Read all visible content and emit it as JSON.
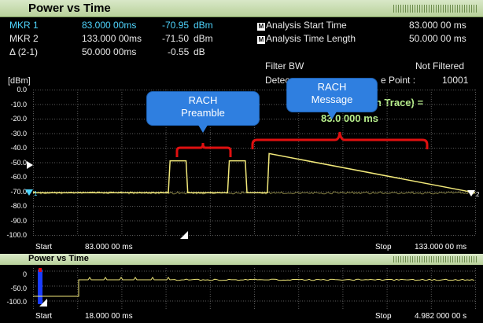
{
  "title": "Power vs Time",
  "markers": [
    {
      "name": "MKR 1",
      "time": "83.000 00ms",
      "value": "-70.95",
      "unit": "dBm"
    },
    {
      "name": "MKR 2",
      "time": "133.000 00ms",
      "value": "-71.50",
      "unit": "dBm"
    },
    {
      "name": "Δ (2-1)",
      "time": "50.000 00ms",
      "value": "-0.55",
      "unit": "dB"
    }
  ],
  "analysis": {
    "start_label": "Analysis Start Time",
    "start_value": "83.000 00 ms",
    "length_label": "Analysis Time Length",
    "length_value": "50.000 00 ms",
    "filter_label": "Filter BW",
    "filter_value": "Not Filtered",
    "detect_label": "Detec",
    "points_label": "e Point :",
    "points_value": "10001",
    "trace_fragment": "n Trace) =",
    "time_fragment": "83.0      000 ms"
  },
  "y_unit": "[dBm]",
  "y_ticks": [
    "0.0",
    "-10.0",
    "-20.0",
    "-30.0",
    "-40.0",
    "-50.0",
    "-60.0",
    "-70.0",
    "-80.0",
    "-90.0",
    "-100.0"
  ],
  "main_footer": {
    "start_label": "Start",
    "start_value": "83.000 00 ms",
    "stop_label": "Stop",
    "stop_value": "133.000 00 ms"
  },
  "marker_flags": {
    "m1": "1",
    "m2": "2"
  },
  "callouts": {
    "preamble": "RACH\nPreamble",
    "message": "RACH\nMessage"
  },
  "overview": {
    "title": "Power vs Time",
    "y_ticks": [
      "0",
      "-50.0",
      "-100.0"
    ],
    "footer": {
      "start_label": "Start",
      "start_value": "18.000 00 ms",
      "stop_label": "Stop",
      "stop_value": "4.982 000 00 s"
    }
  },
  "colors": {
    "trace": "#f2e97a",
    "grid": "#5a5a5a",
    "marker": "#4fd6ff",
    "bracket": "#e01010",
    "callout": "#2f7fe0"
  },
  "chart_data": [
    {
      "type": "line",
      "title": "Power vs Time",
      "ylabel": "[dBm]",
      "xlim": [
        83.0,
        133.0
      ],
      "x_unit": "ms",
      "ylim": [
        -100,
        0
      ],
      "grid": true,
      "series": [
        {
          "x": [
            83.0,
            98.3,
            98.5,
            100.3,
            100.5,
            101.8,
            102.0,
            105.0,
            105.2,
            107.0,
            107.2,
            109.5,
            109.7,
            133.0
          ],
          "y": [
            -71,
            -71,
            -49,
            -49,
            -71,
            -71,
            -71,
            -71,
            -49,
            -49,
            -71,
            -71,
            -44,
            -71
          ]
        }
      ],
      "markers": [
        {
          "x": 83.0,
          "y": -70.95,
          "label": "1"
        },
        {
          "x": 133.0,
          "y": -71.5,
          "label": "2"
        }
      ]
    },
    {
      "type": "line",
      "title": "Power vs Time",
      "xlim": [
        18.0,
        4982.0
      ],
      "x_unit": "ms",
      "ylim": [
        -100,
        0
      ],
      "grid": true
    }
  ]
}
